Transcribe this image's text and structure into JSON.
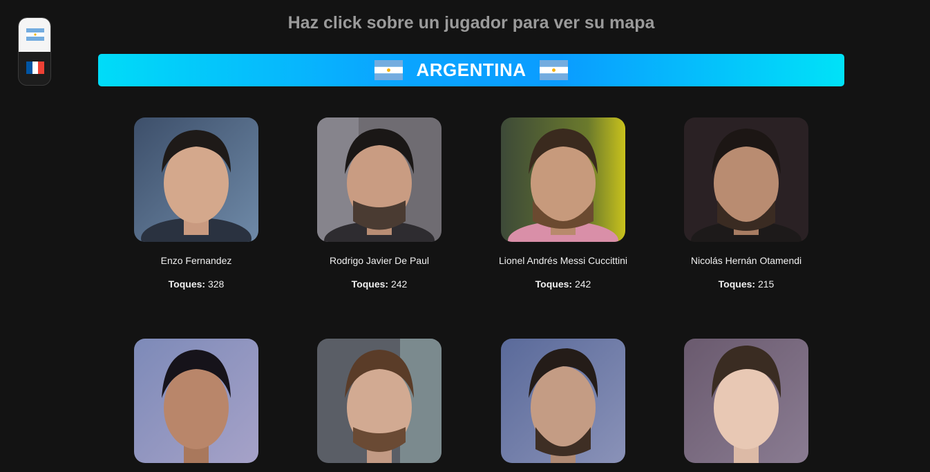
{
  "header": {
    "instruction": "Haz click sobre un jugador para ver su mapa"
  },
  "team_selector": {
    "options": [
      {
        "team": "Argentina",
        "icon": "argentina-flag-icon",
        "selected": true
      },
      {
        "team": "France",
        "icon": "france-flag-icon",
        "selected": false
      }
    ]
  },
  "banner": {
    "title": "ARGENTINA",
    "icon": "argentina-flag-icon"
  },
  "players": [
    {
      "name": "Enzo Fernandez",
      "touches_label": "Toques:",
      "touches": "328"
    },
    {
      "name": "Rodrigo Javier De Paul",
      "touches_label": "Toques:",
      "touches": "242"
    },
    {
      "name": "Lionel Andrés Messi Cuccittini",
      "touches_label": "Toques:",
      "touches": "242"
    },
    {
      "name": "Nicolás Hernán Otamendi",
      "touches_label": "Toques:",
      "touches": "215"
    },
    {
      "name": "",
      "touches_label": "",
      "touches": ""
    },
    {
      "name": "",
      "touches_label": "",
      "touches": ""
    },
    {
      "name": "",
      "touches_label": "",
      "touches": ""
    },
    {
      "name": "",
      "touches_label": "",
      "touches": ""
    }
  ],
  "colors": {
    "background": "#131313",
    "banner_start": "#00dcf8",
    "banner_mid": "#0aa6ff",
    "argentina_blue": "#74acdf",
    "france_blue": "#0055a4",
    "france_red": "#ef4135"
  }
}
